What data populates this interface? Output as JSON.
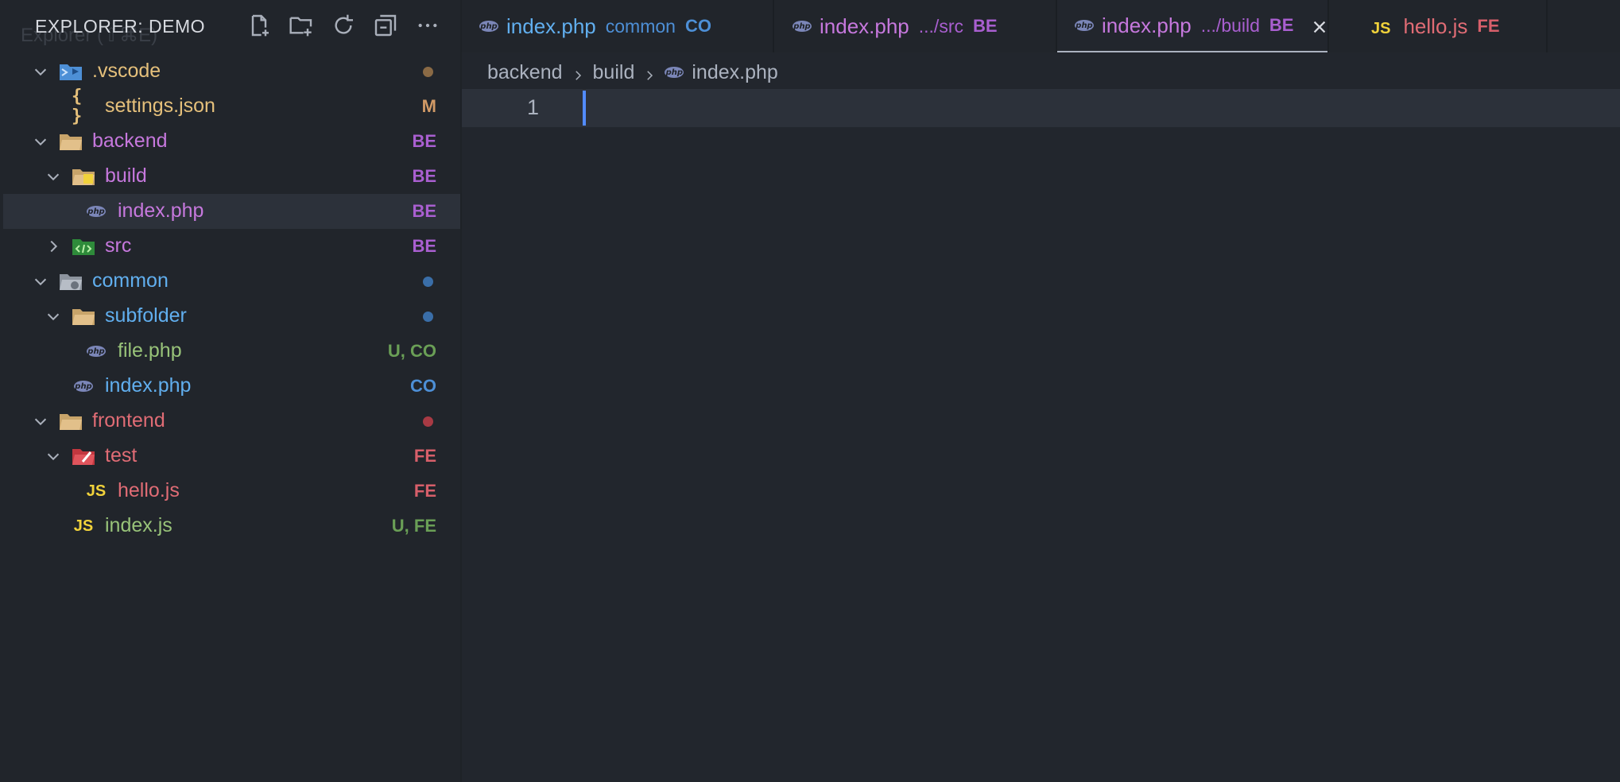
{
  "sidebar": {
    "ghost_title": "Explorer (⇧⌘E)",
    "title": "EXPLORER: DEMO",
    "actions": [
      {
        "name": "new-file",
        "icon": "new-file-icon"
      },
      {
        "name": "new-folder",
        "icon": "new-folder-icon"
      },
      {
        "name": "refresh",
        "icon": "refresh-icon"
      },
      {
        "name": "collapse-all",
        "icon": "collapse-all-icon"
      },
      {
        "name": "more-actions",
        "icon": "ellipsis-icon"
      }
    ],
    "tree": [
      {
        "label": ".vscode",
        "type": "folder",
        "expanded": true,
        "decoration": "dot",
        "dot_color": "#8a6a45"
      },
      {
        "label": "settings.json",
        "type": "file",
        "icon": "json-icon",
        "decoration": "M"
      },
      {
        "label": "backend",
        "type": "folder",
        "expanded": true,
        "decoration": "BE"
      },
      {
        "label": "build",
        "type": "folder",
        "expanded": true,
        "decoration": "BE"
      },
      {
        "label": "index.php",
        "type": "file",
        "icon": "php-icon",
        "decoration": "BE",
        "selected": true
      },
      {
        "label": "src",
        "type": "folder",
        "expanded": false,
        "decoration": "BE"
      },
      {
        "label": "common",
        "type": "folder",
        "expanded": true,
        "decoration": "dot",
        "dot_color": "#3a6ea8"
      },
      {
        "label": "subfolder",
        "type": "folder",
        "expanded": true,
        "decoration": "dot",
        "dot_color": "#3a6ea8"
      },
      {
        "label": "file.php",
        "type": "file",
        "icon": "php-icon",
        "decoration": "U, CO"
      },
      {
        "label": "index.php",
        "type": "file",
        "icon": "php-icon",
        "decoration": "CO"
      },
      {
        "label": "frontend",
        "type": "folder",
        "expanded": true,
        "decoration": "dot",
        "dot_color": "#a83a44"
      },
      {
        "label": "test",
        "type": "folder",
        "expanded": true,
        "decoration": "FE"
      },
      {
        "label": "hello.js",
        "type": "file",
        "icon": "js-icon",
        "decoration": "FE"
      },
      {
        "label": "index.js",
        "type": "file",
        "icon": "js-icon",
        "decoration": "U, FE"
      }
    ]
  },
  "tabs": [
    {
      "label": "index.php",
      "description": "common",
      "badge": "CO",
      "icon": "php-icon",
      "active": false
    },
    {
      "label": "index.php",
      "description": ".../src",
      "badge": "BE",
      "icon": "php-icon",
      "active": false
    },
    {
      "label": "index.php",
      "description": ".../build",
      "badge": "BE",
      "icon": "php-icon",
      "active": true
    },
    {
      "label": "hello.js",
      "description": "",
      "badge": "FE",
      "icon": "js-icon",
      "active": false
    }
  ],
  "icon_text": {
    "php": "php",
    "js": "JS",
    "json": "{ }"
  },
  "breadcrumb": [
    "backend",
    "build",
    "index.php"
  ],
  "editor": {
    "line_number": "1"
  },
  "colors": {
    "backend": "#c678dd",
    "common": "#61afef",
    "untracked": "#98c379",
    "frontend": "#e06c75",
    "modified": "#d19a66",
    "cursor": "#528bff"
  }
}
